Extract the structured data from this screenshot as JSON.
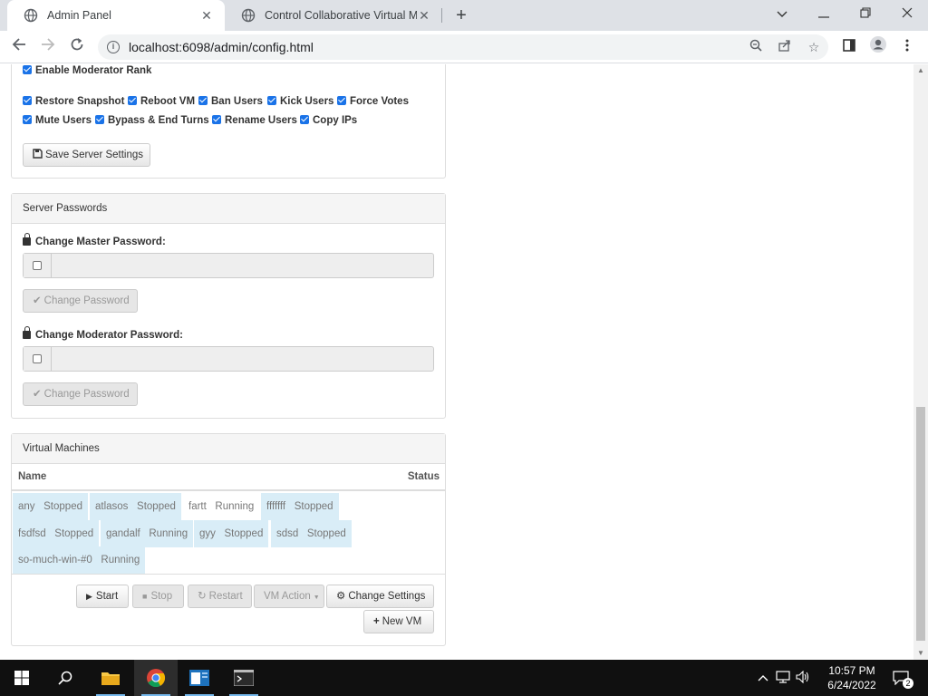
{
  "browser": {
    "tabs": [
      {
        "title": "Admin Panel"
      },
      {
        "title": "Control Collaborative Virtual Mac"
      }
    ],
    "url": "localhost:6098/admin/config.html"
  },
  "permissions": {
    "enable_moderator": "Enable Moderator Rank",
    "row1": [
      "Restore Snapshot",
      "Reboot VM",
      "Ban Users",
      "Kick Users",
      "Force Votes"
    ],
    "row2": [
      "Mute Users",
      "Bypass & End Turns",
      "Rename Users",
      "Copy IPs"
    ],
    "save_label": "Save Server Settings"
  },
  "passwords": {
    "heading": "Server Passwords",
    "master_label": "Change Master Password:",
    "moderator_label": "Change Moderator Password:",
    "change_label": "Change Password"
  },
  "vms": {
    "heading": "Virtual Machines",
    "col_name": "Name",
    "col_status": "Status",
    "items": [
      {
        "name": "any",
        "status": "Stopped"
      },
      {
        "name": "atlasos",
        "status": "Stopped"
      },
      {
        "name": "fartt",
        "status": "Running"
      },
      {
        "name": "fffffff",
        "status": "Stopped"
      },
      {
        "name": "fsdfsd",
        "status": "Stopped"
      },
      {
        "name": "gandalf",
        "status": "Running"
      },
      {
        "name": "gyy",
        "status": "Stopped"
      },
      {
        "name": "sdsd",
        "status": "Stopped"
      },
      {
        "name": "so-much-win-#0",
        "status": "Running"
      }
    ],
    "actions": {
      "start": "Start",
      "stop": "Stop",
      "restart": "Restart",
      "vm_action": "VM Action",
      "change_settings": "Change Settings",
      "new_vm": "New VM"
    }
  },
  "taskbar": {
    "time": "10:57 PM",
    "date": "6/24/2022",
    "notifications": "2"
  }
}
